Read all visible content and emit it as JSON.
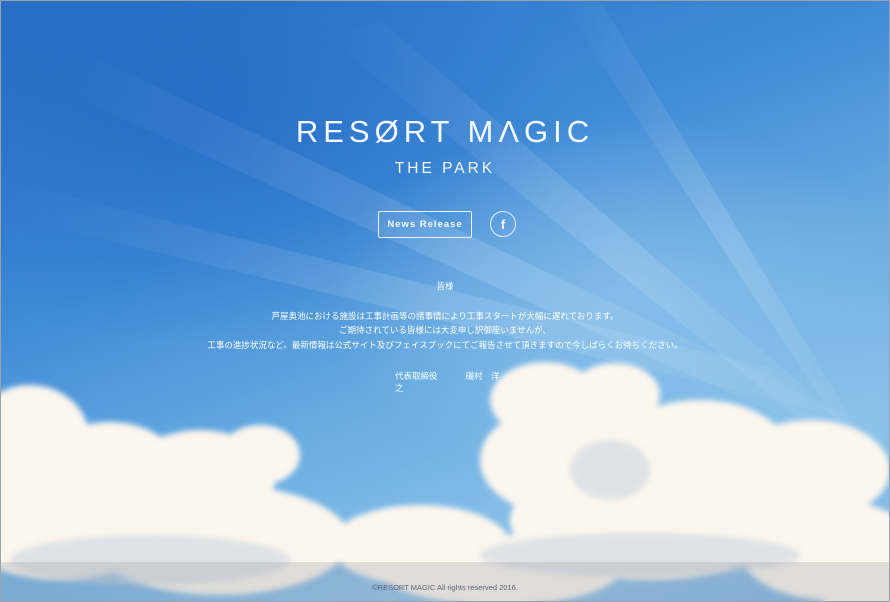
{
  "brand": {
    "title": "RESØRT MΛGIC",
    "subtitle": "THE PARK"
  },
  "nav": {
    "news_label": "News Release",
    "facebook_glyph": "f",
    "facebook_icon": "facebook-icon"
  },
  "notice": {
    "greeting": "皆様",
    "lines": [
      "芦屋奥池における施設は工事計画等の諸事情により工事スタートが大幅に遅れております。",
      "ご期待されている皆様には大変申し訳御座いませんが、",
      "工事の進捗状況など、最新情報は公式サイト及びフェイスブックにてご報告させて頂きますので今しばらくお待ちください。"
    ],
    "sign_title": "代表取締役",
    "sign_name": "磯村　洋之"
  },
  "footer": {
    "copyright": "©RESORT MAGIC All rights reserved 2016."
  },
  "colors": {
    "sky_top": "#2a6fc8",
    "sky_bottom": "#8cc2e9",
    "cloud": "#fbf6ef",
    "text": "#ffffff"
  }
}
